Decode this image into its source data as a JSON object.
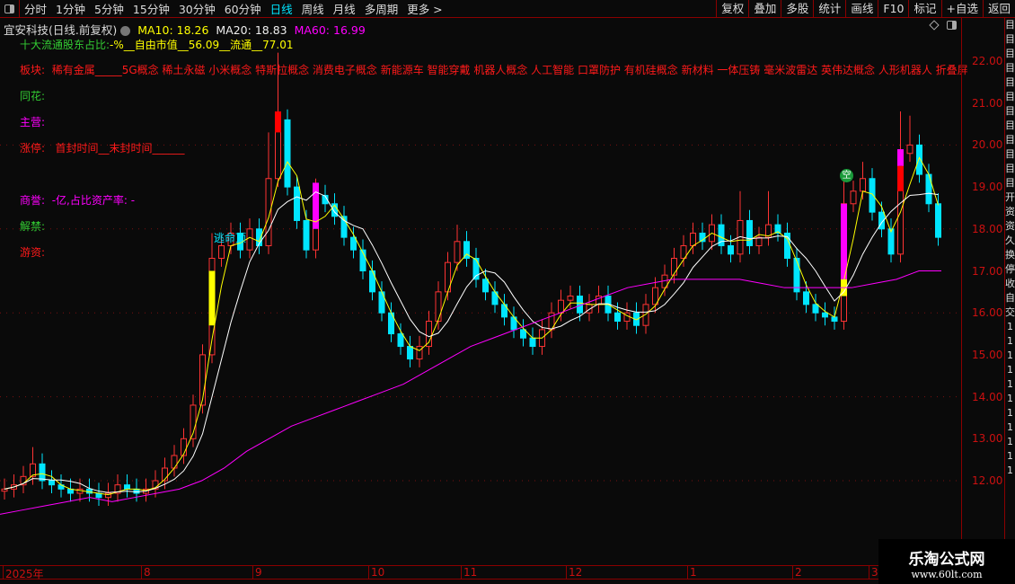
{
  "toolbar": {
    "periods": [
      "分时",
      "1分钟",
      "5分钟",
      "15分钟",
      "30分钟",
      "60分钟",
      "日线",
      "周线",
      "月线",
      "多周期",
      "更多 >"
    ],
    "active": "日线",
    "right_buttons": [
      "复权",
      "叠加",
      "多股",
      "统计",
      "画线",
      "F10",
      "标记",
      "+自选",
      "返回"
    ]
  },
  "header": {
    "title": "宜安科技(日线.前复权)",
    "ma10": "MA10: 18.26",
    "ma20": "MA20: 18.83",
    "ma60": "MA60: 16.99",
    "holders_label": "十大流通股东占比:",
    "holders_value": "-%__自由市值__56.09__流通__77.01"
  },
  "info": {
    "sector_label": "板块:",
    "sector_value": "稀有金属_____5G概念 稀土永磁 小米概念 特斯拉概念 消费电子概念 新能源车 智能穿戴 机器人概念 人工智能 口罩防护 有机硅概念 新材料 一体压铸 毫米波雷达 英伟达概念 人形机器人 折叠屏",
    "tonghua_label": "同花:",
    "main_label": "主营:",
    "limit_label": "涨停:",
    "limit_value": "首封时间__末封时间______",
    "goodwill_label": "商誉:",
    "goodwill_value": "-亿,占比资产率: -",
    "unlock_label": "解禁:",
    "hot_label": "游资:"
  },
  "markers": {
    "escape": "逃命顶",
    "short": "空"
  },
  "colors": {
    "up": "#ff3333",
    "down": "#00e5ff",
    "ma10": "#ffff00",
    "ma20": "#ffffff",
    "ma60": "#ff00ff",
    "axis": "#8b0000"
  },
  "chart_data": {
    "type": "candlestick",
    "ylim": [
      11,
      22.5
    ],
    "price_ticks": [
      "22.00",
      "21.00",
      "20.00",
      "19.00",
      "18.00",
      "17.00",
      "16.00",
      "15.00",
      "14.00",
      "13.00",
      "12.00"
    ],
    "date_ticks": [
      "2025年",
      "8",
      "9",
      "10",
      "11",
      "12",
      "1",
      "2",
      "3"
    ],
    "closes": [
      11.8,
      11.9,
      12.1,
      12.4,
      12.0,
      11.9,
      11.8,
      11.7,
      11.8,
      11.7,
      11.6,
      11.7,
      11.9,
      11.8,
      11.7,
      11.8,
      12.0,
      12.3,
      12.6,
      13.0,
      13.8,
      15.0,
      17.3,
      17.6,
      17.9,
      17.5,
      18.0,
      17.6,
      19.2,
      20.6,
      19.0,
      18.2,
      17.5,
      18.8,
      18.6,
      18.3,
      17.8,
      17.5,
      17.0,
      16.5,
      16.0,
      15.5,
      15.2,
      14.9,
      15.2,
      15.8,
      16.5,
      17.2,
      17.7,
      17.3,
      16.8,
      16.5,
      16.2,
      15.9,
      15.6,
      15.4,
      15.2,
      15.6,
      16.0,
      16.3,
      16.4,
      16.0,
      16.2,
      16.4,
      16.0,
      15.8,
      16.0,
      15.7,
      16.2,
      16.6,
      16.9,
      17.3,
      17.6,
      17.9,
      17.7,
      18.1,
      17.6,
      17.4,
      18.2,
      17.6,
      17.8,
      18.1,
      17.9,
      17.3,
      16.5,
      16.2,
      16.0,
      15.9,
      15.8,
      18.6,
      18.9,
      19.2,
      18.4,
      18.0,
      17.4,
      19.8,
      20.0,
      19.3,
      18.6,
      17.8
    ],
    "highs": {
      "3": 12.8,
      "22": 17.9,
      "28": 20.3,
      "29": 22.2,
      "33": 19.2,
      "48": 18.1,
      "78": 18.9,
      "81": 18.9,
      "89": 19.4,
      "91": 19.6,
      "95": 20.8,
      "96": 20.7
    },
    "ma60": [
      11.2,
      11.3,
      11.4,
      11.5,
      11.6,
      11.5,
      11.6,
      11.7,
      11.8,
      12.0,
      12.3,
      12.7,
      13.0,
      13.3,
      13.5,
      13.7,
      13.9,
      14.1,
      14.3,
      14.6,
      14.9,
      15.2,
      15.4,
      15.6,
      15.8,
      16.0,
      16.2,
      16.4,
      16.6,
      16.7,
      16.8,
      16.8,
      16.8,
      16.8,
      16.7,
      16.6,
      16.6,
      16.6,
      16.6,
      16.7,
      16.8,
      17.0,
      17.0
    ]
  }
}
